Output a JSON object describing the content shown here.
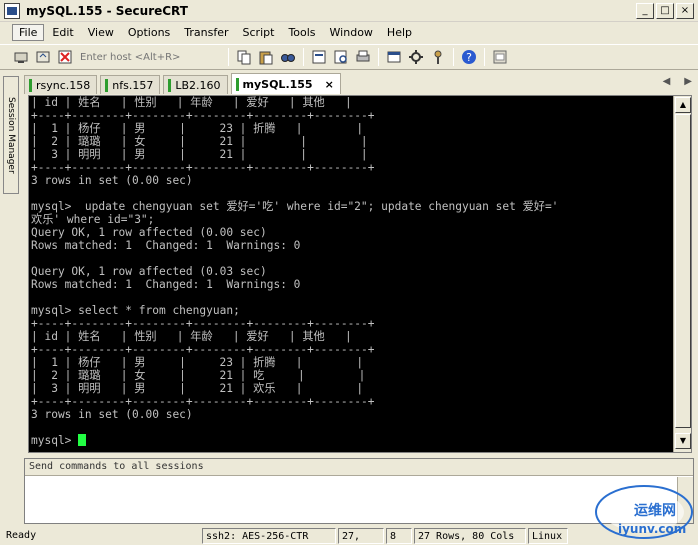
{
  "window": {
    "title": "mySQL.155 - SecureCRT",
    "controls": [
      "_",
      "□",
      "×"
    ]
  },
  "menu": [
    "File",
    "Edit",
    "View",
    "Options",
    "Transfer",
    "Script",
    "Tools",
    "Window",
    "Help"
  ],
  "toolbar": {
    "host_placeholder": "Enter host <Alt+R>"
  },
  "session_manager": {
    "label": "Session Manager"
  },
  "tabs": [
    {
      "label": "rsync.158",
      "active": false
    },
    {
      "label": "nfs.157",
      "active": false
    },
    {
      "label": "LB2.160",
      "active": false
    },
    {
      "label": "mySQL.155",
      "active": true,
      "close": "×"
    }
  ],
  "terminal": {
    "lines": [
      "| id | 姓名   | 性别   | 年龄   | 爱好   | 其他   |",
      "+----+--------+--------+--------+--------+--------+",
      "|  1 | 杨仔   | 男     |     23 | 折腾   |        |",
      "|  2 | 璐璐   | 女     |     21 |        |        |",
      "|  3 | 明明   | 男     |     21 |        |        |",
      "+----+--------+--------+--------+--------+--------+",
      "3 rows in set (0.00 sec)",
      "",
      "mysql>  update chengyuan set 爱好='吃' where id=\"2\"; update chengyuan set 爱好='",
      "欢乐' where id=\"3\";",
      "Query OK, 1 row affected (0.00 sec)",
      "Rows matched: 1  Changed: 1  Warnings: 0",
      "",
      "Query OK, 1 row affected (0.03 sec)",
      "Rows matched: 1  Changed: 1  Warnings: 0",
      "",
      "mysql> select * from chengyuan;",
      "+----+--------+--------+--------+--------+--------+",
      "| id | 姓名   | 性别   | 年龄   | 爱好   | 其他   |",
      "+----+--------+--------+--------+--------+--------+",
      "|  1 | 杨仔   | 男     |     23 | 折腾   |        |",
      "|  2 | 璐璐   | 女     |     21 | 吃     |        |",
      "|  3 | 明明   | 男     |     21 | 欢乐   |        |",
      "+----+--------+--------+--------+--------+--------+",
      "3 rows in set (0.00 sec)",
      "",
      "mysql> "
    ]
  },
  "send_commands": {
    "label": "Send commands to all sessions"
  },
  "statusbar": {
    "ready": "Ready",
    "protocol": "ssh2: AES-256-CTR",
    "row": "27,",
    "col": "8",
    "size": "27 Rows, 80 Cols",
    "terminal_type": "Linux"
  },
  "watermark": {
    "text1": "运维网",
    "text2": "iyunv.com"
  }
}
